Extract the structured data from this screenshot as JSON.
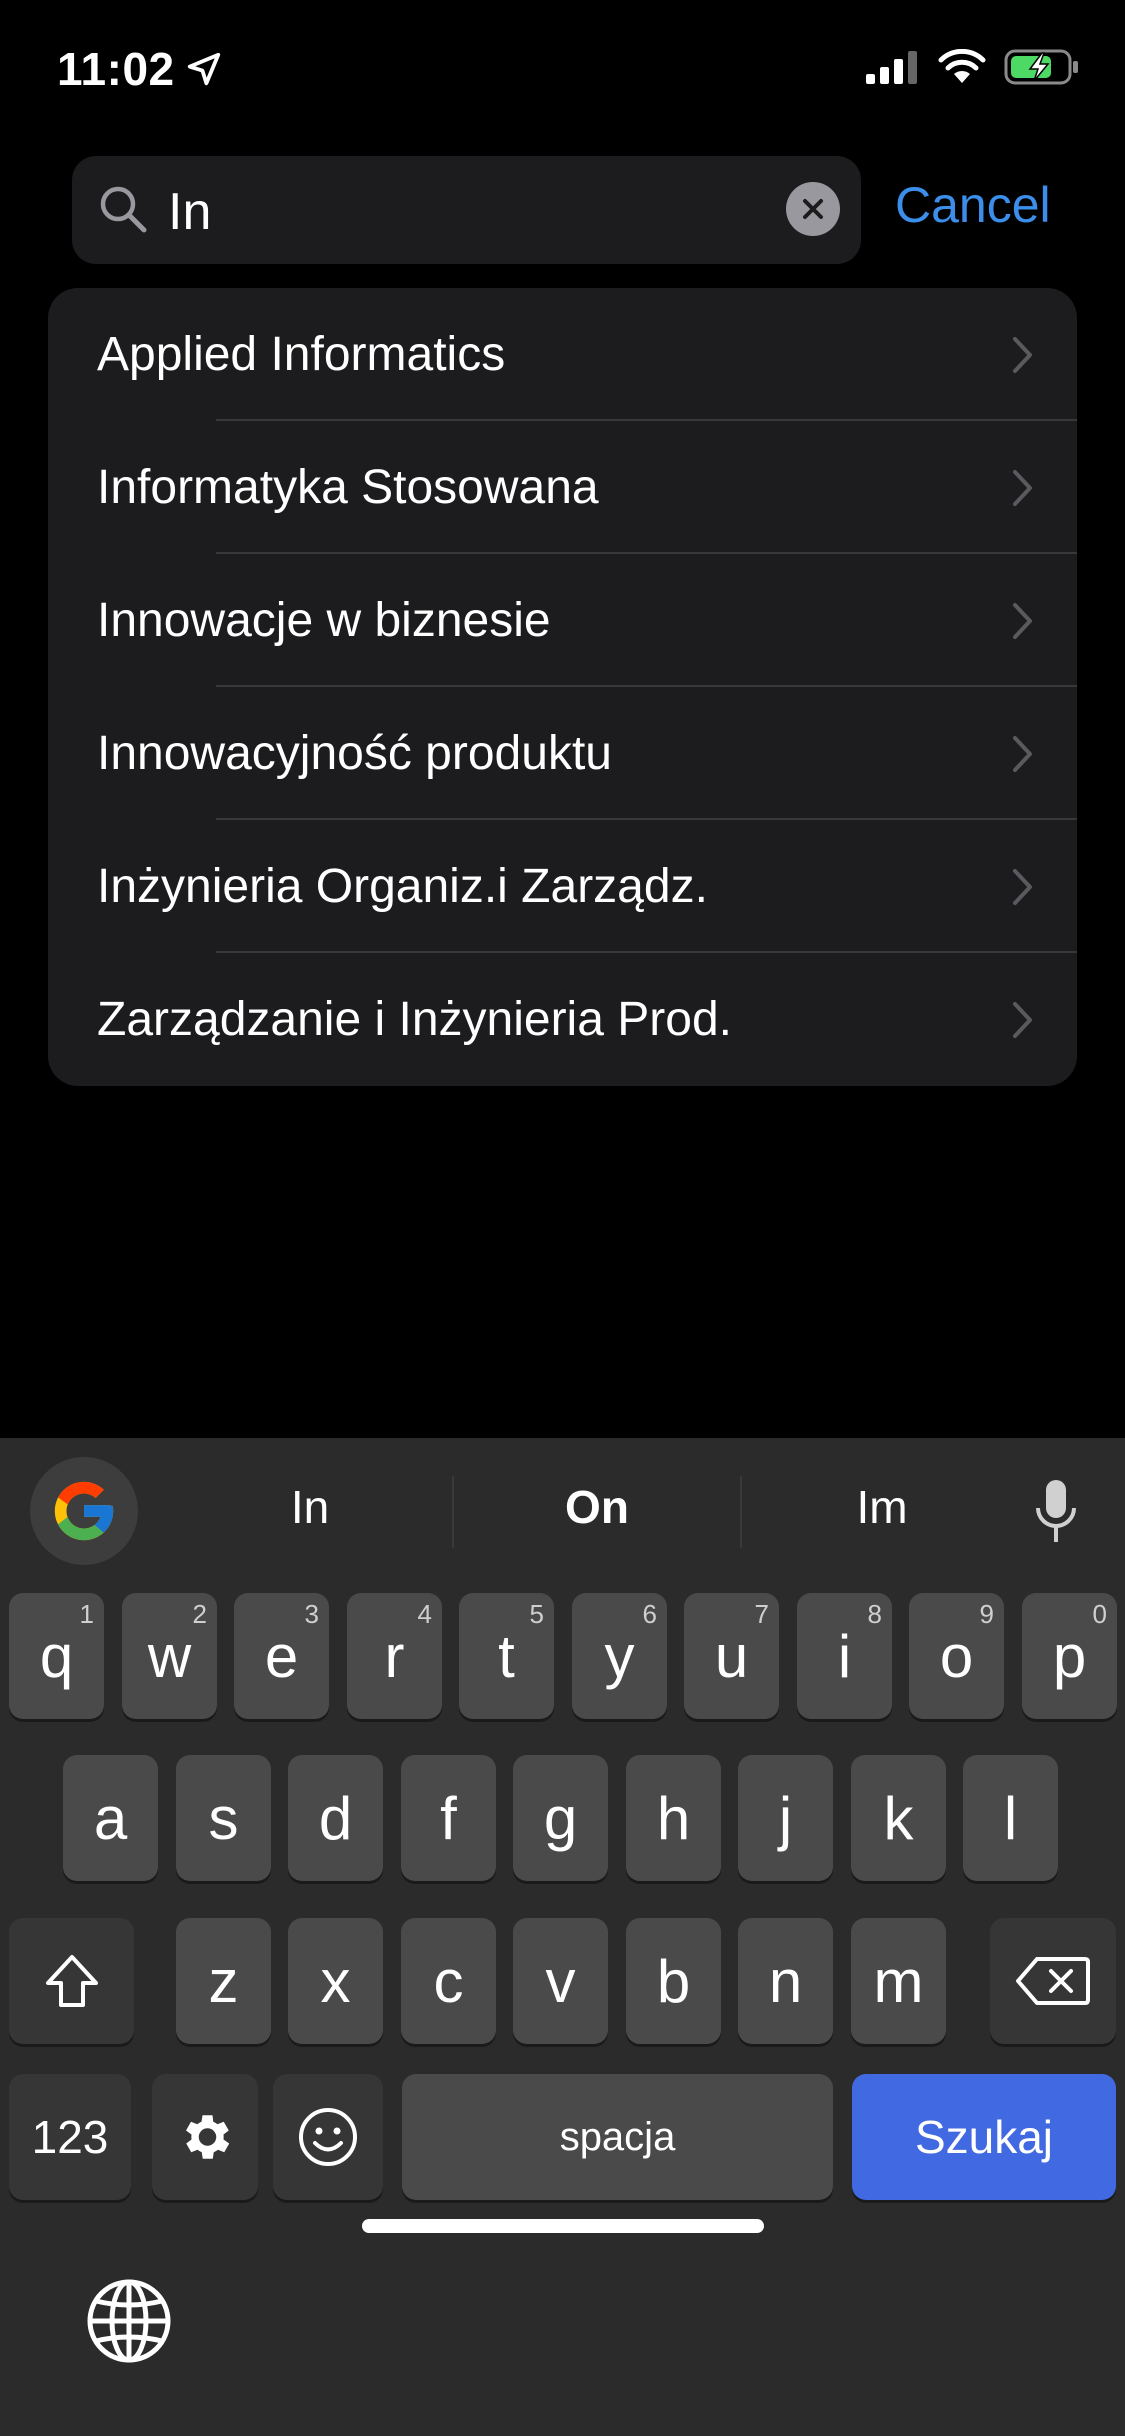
{
  "status_bar": {
    "time": "11:02"
  },
  "search": {
    "value": "In",
    "cancel_label": "Cancel"
  },
  "results": [
    {
      "label": "Applied Informatics"
    },
    {
      "label": "Informatyka Stosowana"
    },
    {
      "label": "Innowacje w biznesie"
    },
    {
      "label": "Innowacyjność produktu"
    },
    {
      "label": "Inżynieria Organiz.i Zarządz."
    },
    {
      "label": "Zarządzanie i Inżynieria Prod."
    }
  ],
  "keyboard": {
    "suggestions": [
      "In",
      "On",
      "Im"
    ],
    "row1": [
      {
        "ch": "q",
        "num": "1"
      },
      {
        "ch": "w",
        "num": "2"
      },
      {
        "ch": "e",
        "num": "3"
      },
      {
        "ch": "r",
        "num": "4"
      },
      {
        "ch": "t",
        "num": "5"
      },
      {
        "ch": "y",
        "num": "6"
      },
      {
        "ch": "u",
        "num": "7"
      },
      {
        "ch": "i",
        "num": "8"
      },
      {
        "ch": "o",
        "num": "9"
      },
      {
        "ch": "p",
        "num": "0"
      }
    ],
    "row2": [
      "a",
      "s",
      "d",
      "f",
      "g",
      "h",
      "j",
      "k",
      "l"
    ],
    "row3": [
      "z",
      "x",
      "c",
      "v",
      "b",
      "n",
      "m"
    ],
    "numbers_label": "123",
    "space_label": "spacja",
    "search_label": "Szukaj"
  },
  "colors": {
    "accent": "#3b8eea",
    "search_key": "#4169e1"
  },
  "icons": [
    "location-arrow-icon",
    "signal-icon",
    "wifi-icon",
    "battery-charging-icon",
    "search-icon",
    "clear-icon",
    "chevron-right-icon",
    "google-icon",
    "mic-icon",
    "shift-icon",
    "backspace-icon",
    "gear-icon",
    "emoji-icon",
    "globe-icon"
  ]
}
